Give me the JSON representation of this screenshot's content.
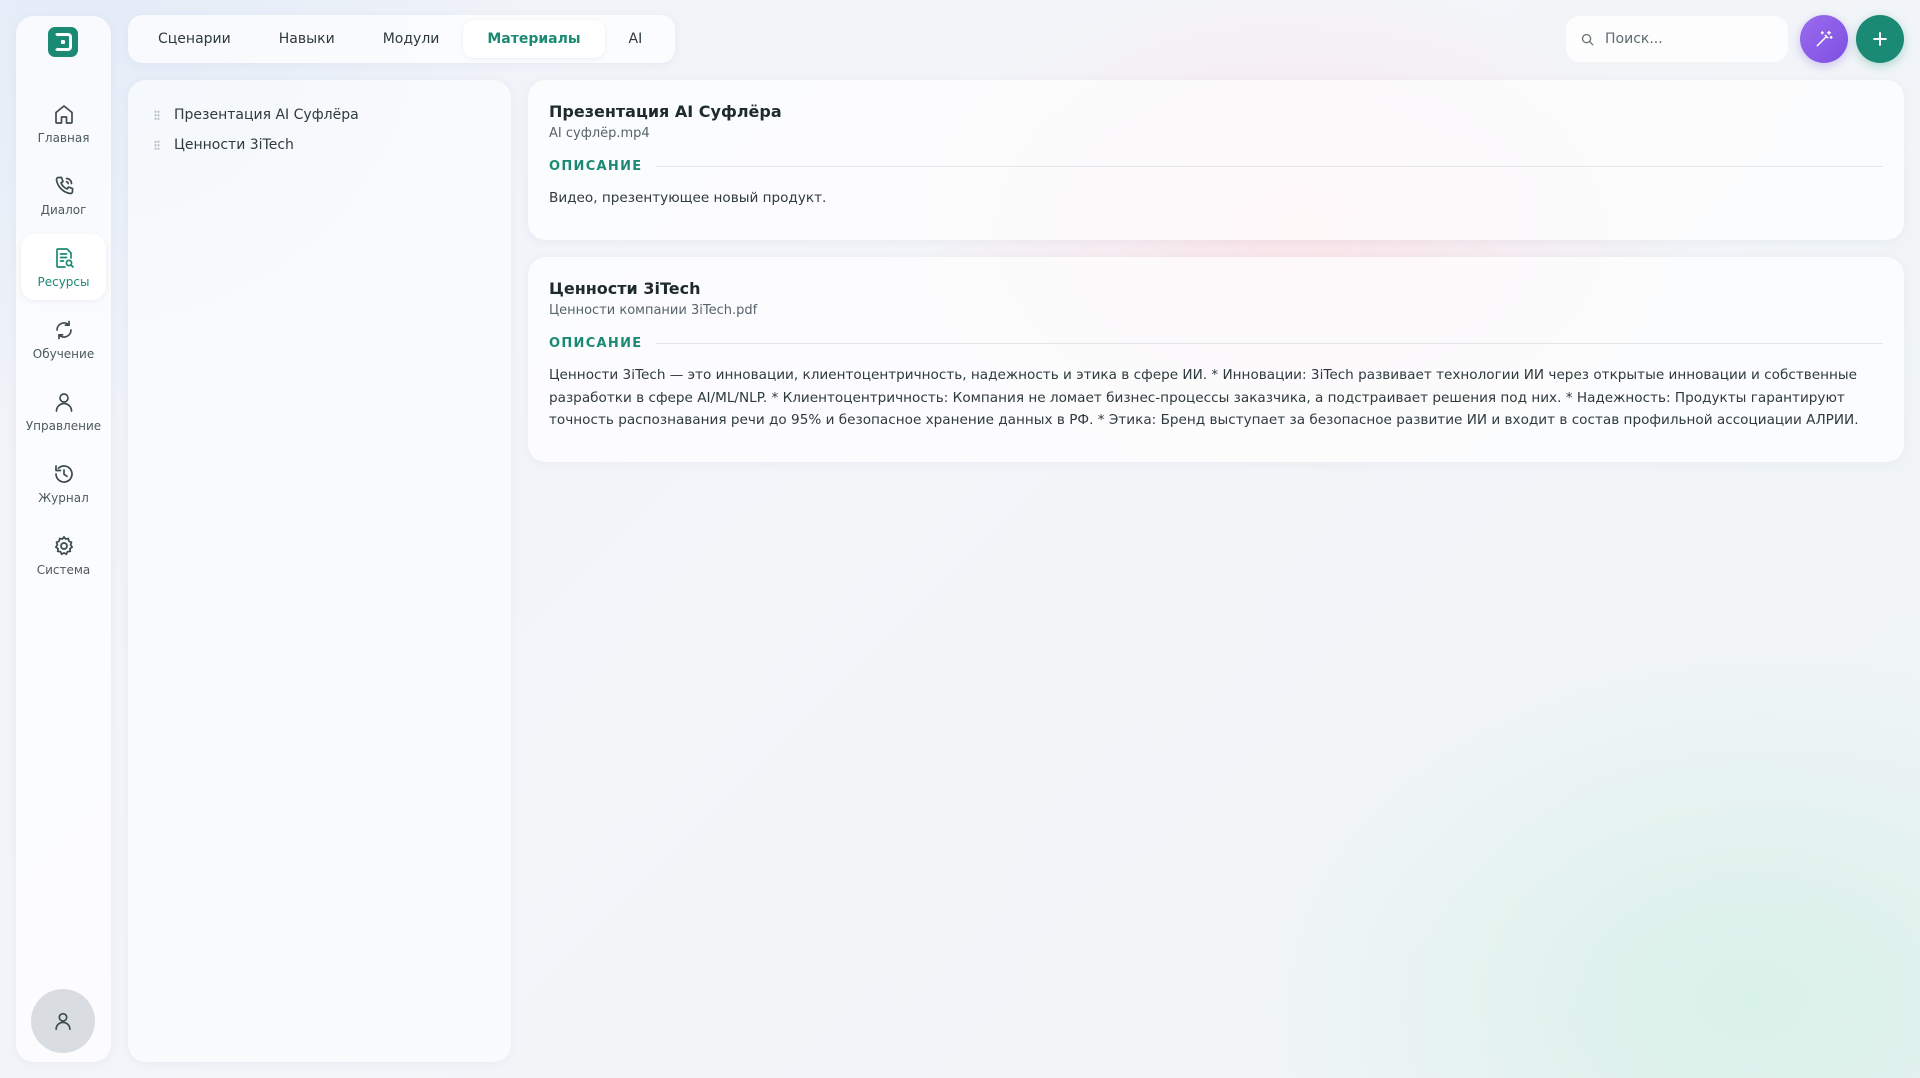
{
  "app": {
    "brand_color": "#1b8a74",
    "accent_purple": "#8b5cf6"
  },
  "sidebar": {
    "items": [
      {
        "label": "Главная",
        "icon": "home-icon",
        "active": false
      },
      {
        "label": "Диалог",
        "icon": "phone-icon",
        "active": false
      },
      {
        "label": "Ресурсы",
        "icon": "document-search-icon",
        "active": true
      },
      {
        "label": "Обучение",
        "icon": "refresh-icon",
        "active": false
      },
      {
        "label": "Управление",
        "icon": "user-icon",
        "active": false
      },
      {
        "label": "Журнал",
        "icon": "history-icon",
        "active": false
      },
      {
        "label": "Система",
        "icon": "gear-icon",
        "active": false
      }
    ]
  },
  "tabs": {
    "items": [
      {
        "label": "Сценарии",
        "active": false
      },
      {
        "label": "Навыки",
        "active": false
      },
      {
        "label": "Модули",
        "active": false
      },
      {
        "label": "Материалы",
        "active": true
      },
      {
        "label": "AI",
        "active": false
      }
    ]
  },
  "search": {
    "placeholder": "Поиск...",
    "value": ""
  },
  "materials_list": [
    {
      "label": "Презентация AI Суфлёра"
    },
    {
      "label": "Ценности 3iTech"
    }
  ],
  "materials": [
    {
      "title": "Презентация AI Суфлёра",
      "file": "AI суфлёр.mp4",
      "description_label": "ОПИСАНИЕ",
      "description": "Видео, презентующее новый продукт."
    },
    {
      "title": "Ценности 3iTech",
      "file": "Ценности компании 3iTech.pdf",
      "description_label": "ОПИСАНИЕ",
      "description": "Ценности 3iTech — это инновации, клиентоцентричность, надежность и этика в сфере ИИ. * Инновации: 3iTech развивает технологии ИИ через открытые инновации и собственные разработки в сфере AI/ML/NLP. * Клиентоцентричность: Компания не ломает бизнес-процессы заказчика, а подстраивает решения под них. * Надежность: Продукты гарантируют точность распознавания речи до 95% и безопасное хранение данных в РФ. * Этика: Бренд выступает за безопасное развитие ИИ и входит в состав профильной ассоциации АЛРИИ."
    }
  ]
}
